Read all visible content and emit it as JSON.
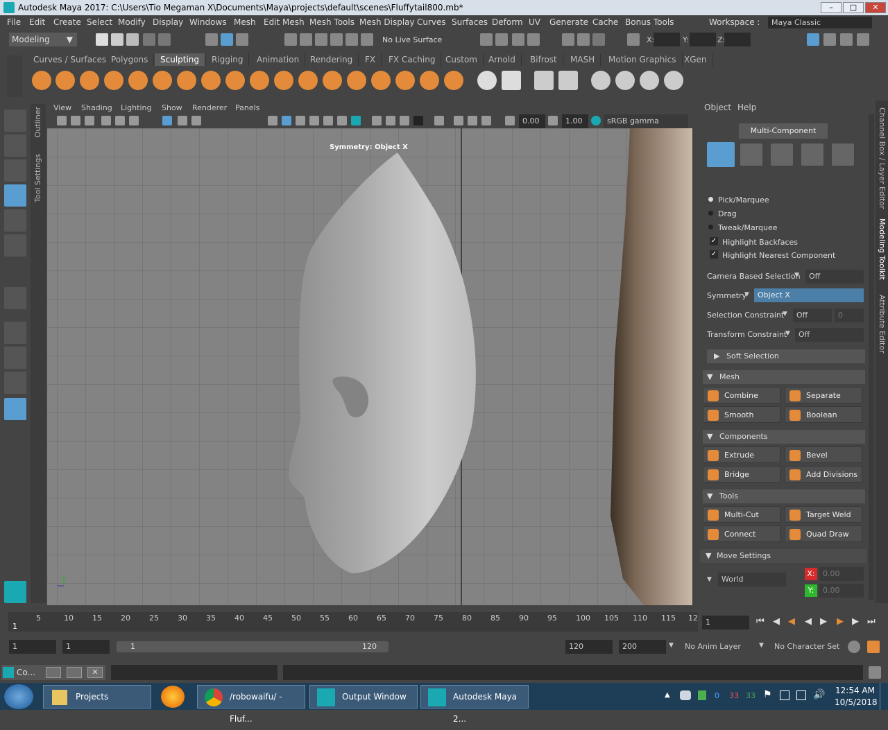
{
  "window": {
    "title": "Autodesk Maya 2017: C:\\Users\\Tio Megaman X\\Documents\\Maya\\projects\\default\\scenes\\Fluffytail800.mb*"
  },
  "menus": [
    "File",
    "Edit",
    "Create",
    "Select",
    "Modify",
    "Display",
    "Windows",
    "Mesh",
    "Edit Mesh",
    "Mesh Tools",
    "Mesh Display",
    "Curves",
    "Surfaces",
    "Deform",
    "UV",
    "Generate",
    "Cache",
    "Bonus Tools"
  ],
  "workspace": {
    "label": "Workspace :",
    "value": "Maya Classic"
  },
  "status": {
    "mode": "Modeling",
    "live_surface": "No Live Surface",
    "x_label": "X:",
    "y_label": "Y:",
    "z_label": "Z:"
  },
  "shelf_tabs": [
    "Curves / Surfaces",
    "Polygons",
    "Sculpting",
    "Rigging",
    "Animation",
    "Rendering",
    "FX",
    "FX Caching",
    "Custom",
    "Arnold",
    "Bifrost",
    "MASH",
    "Motion Graphics",
    "XGen"
  ],
  "active_shelf": "Sculpting",
  "side_tabs": {
    "outliner": "Outliner",
    "tool_settings": "Tool Settings"
  },
  "viewport": {
    "menus": [
      "View",
      "Shading",
      "Lighting",
      "Show",
      "Renderer",
      "Panels"
    ],
    "value1": "0.00",
    "value2": "1.00",
    "color_space": "sRGB gamma",
    "symmetry_label": "Symmetry: Object X"
  },
  "right_panel": {
    "menus": [
      "Object",
      "Help"
    ],
    "mode_button": "Multi-Component",
    "radio_pick": "Pick/Marquee",
    "radio_drag": "Drag",
    "radio_tweak": "Tweak/Marquee",
    "check_backfaces": "Highlight Backfaces",
    "check_nearest": "Highlight Nearest Component",
    "camera_sel_label": "Camera Based Selection",
    "camera_sel_value": "Off",
    "symmetry_label": "Symmetry",
    "symmetry_value": "Object X",
    "sel_constraint_label": "Selection Constraint",
    "sel_constraint_value": "Off",
    "sel_constraint_num": "0",
    "transform_constraint_label": "Transform Constraint",
    "transform_constraint_value": "Off",
    "soft_selection": "Soft Selection",
    "mesh_section": "Mesh",
    "combine": "Combine",
    "separate": "Separate",
    "smooth": "Smooth",
    "boolean": "Boolean",
    "components_section": "Components",
    "extrude": "Extrude",
    "bevel": "Bevel",
    "bridge": "Bridge",
    "add_divisions": "Add Divisions",
    "tools_section": "Tools",
    "multi_cut": "Multi-Cut",
    "target_weld": "Target Weld",
    "connect": "Connect",
    "quad_draw": "Quad Draw",
    "move_settings": "Move Settings",
    "world": "World",
    "x_label": "X:",
    "x_value": "0.00",
    "y_label": "Y:",
    "y_value": "0.00"
  },
  "right_tabs": {
    "channel_box": "Channel Box / Layer Editor",
    "modeling_toolkit": "Modeling Toolkit",
    "attribute_editor": "Attribute Editor"
  },
  "timeline": {
    "ticks": [
      "5",
      "10",
      "15",
      "20",
      "25",
      "30",
      "35",
      "40",
      "45",
      "50",
      "55",
      "60",
      "65",
      "70",
      "75",
      "80",
      "85",
      "90",
      "95",
      "100",
      "105",
      "110",
      "115",
      "12"
    ],
    "current": "1",
    "frame_field": "1"
  },
  "range": {
    "start1": "1",
    "start2": "1",
    "slider_start": "1",
    "slider_end": "120",
    "end1": "120",
    "end2": "200",
    "anim_layer": "No Anim Layer",
    "char_set": "No Character Set"
  },
  "cmd": {
    "label": "Co..."
  },
  "taskbar": {
    "items": [
      "Projects",
      "/robowaifu/ - Fluf...",
      "Output Window",
      "Autodesk Maya 2..."
    ],
    "time": "12:54 AM",
    "date": "10/5/2018",
    "tray_nums": [
      "0",
      "33",
      "33"
    ]
  }
}
